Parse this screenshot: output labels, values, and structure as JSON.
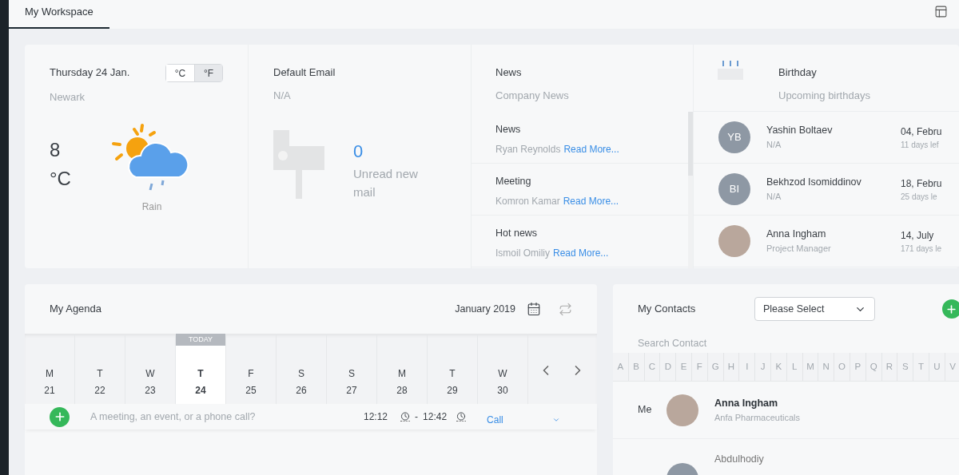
{
  "tabs": [
    {
      "label": "My Workspace",
      "selected": true
    }
  ],
  "weather": {
    "date": "Thursday 24 Jan.",
    "location": "Newark",
    "units": [
      {
        "label": "°C",
        "selected": false
      },
      {
        "label": "°F",
        "selected": true
      }
    ],
    "temperature": "8",
    "unit": "°C",
    "condition": "Rain"
  },
  "email": {
    "title": "Default Email",
    "account": "N/A",
    "count": "0",
    "label": "Unread new mail"
  },
  "news": {
    "title": "News",
    "subtitle": "Company News",
    "items": [
      {
        "title": "News",
        "author": "Ryan Reynolds",
        "link": "Read More..."
      },
      {
        "title": "Meeting",
        "author": "Komron Kamar",
        "link": "Read More..."
      },
      {
        "title": "Hot news",
        "author": "Ismoil Omiliy",
        "link": "Read More..."
      }
    ]
  },
  "birthday": {
    "title": "Birthday",
    "subtitle": "Upcoming birthdays",
    "people": [
      {
        "kind": "initials",
        "initials": "YB",
        "name": "Yashin Boltaev",
        "role": "N/A",
        "date": "04, Febru",
        "days_left": "11 days lef"
      },
      {
        "kind": "initials",
        "initials": "BI",
        "name": "Bekhzod Isomiddinov",
        "role": "N/A",
        "date": "18, Febru",
        "days_left": "25 days le"
      },
      {
        "kind": "photo",
        "name": "Anna Ingham",
        "role": "Project Manager",
        "date": "14, July",
        "days_left": "171 days le"
      }
    ]
  },
  "agenda": {
    "title": "My Agenda",
    "month": "January 2019",
    "today_label": "TODAY",
    "days": [
      {
        "weekday": "M",
        "day": "21",
        "selected": false
      },
      {
        "weekday": "T",
        "day": "22",
        "selected": false
      },
      {
        "weekday": "W",
        "day": "23",
        "selected": false
      },
      {
        "weekday": "T",
        "day": "24",
        "selected": true
      },
      {
        "weekday": "F",
        "day": "25",
        "selected": false
      },
      {
        "weekday": "S",
        "day": "26",
        "selected": false
      },
      {
        "weekday": "S",
        "day": "27",
        "selected": false
      },
      {
        "weekday": "M",
        "day": "28",
        "selected": false
      },
      {
        "weekday": "T",
        "day": "29",
        "selected": false
      },
      {
        "weekday": "W",
        "day": "30",
        "selected": false
      }
    ],
    "event_placeholder": "A meeting, an event, or a phone call?",
    "start_time": "12:12",
    "separator": "-",
    "end_time": "12:42",
    "type": "Call"
  },
  "contacts": {
    "title": "My Contacts",
    "filter": "Please Select",
    "search_placeholder": "Search Contact",
    "letters": [
      "A",
      "B",
      "C",
      "D",
      "E",
      "F",
      "G",
      "H",
      "I",
      "J",
      "K",
      "L",
      "M",
      "N",
      "O",
      "P",
      "Q",
      "R",
      "S",
      "T",
      "U",
      "V"
    ],
    "items": [
      {
        "kind": "photo",
        "tag": "Me",
        "name": "Anna Ingham",
        "company": "Anfa Pharmaceuticals"
      },
      {
        "kind": "initials",
        "name": "Abdulhodiy"
      }
    ]
  }
}
